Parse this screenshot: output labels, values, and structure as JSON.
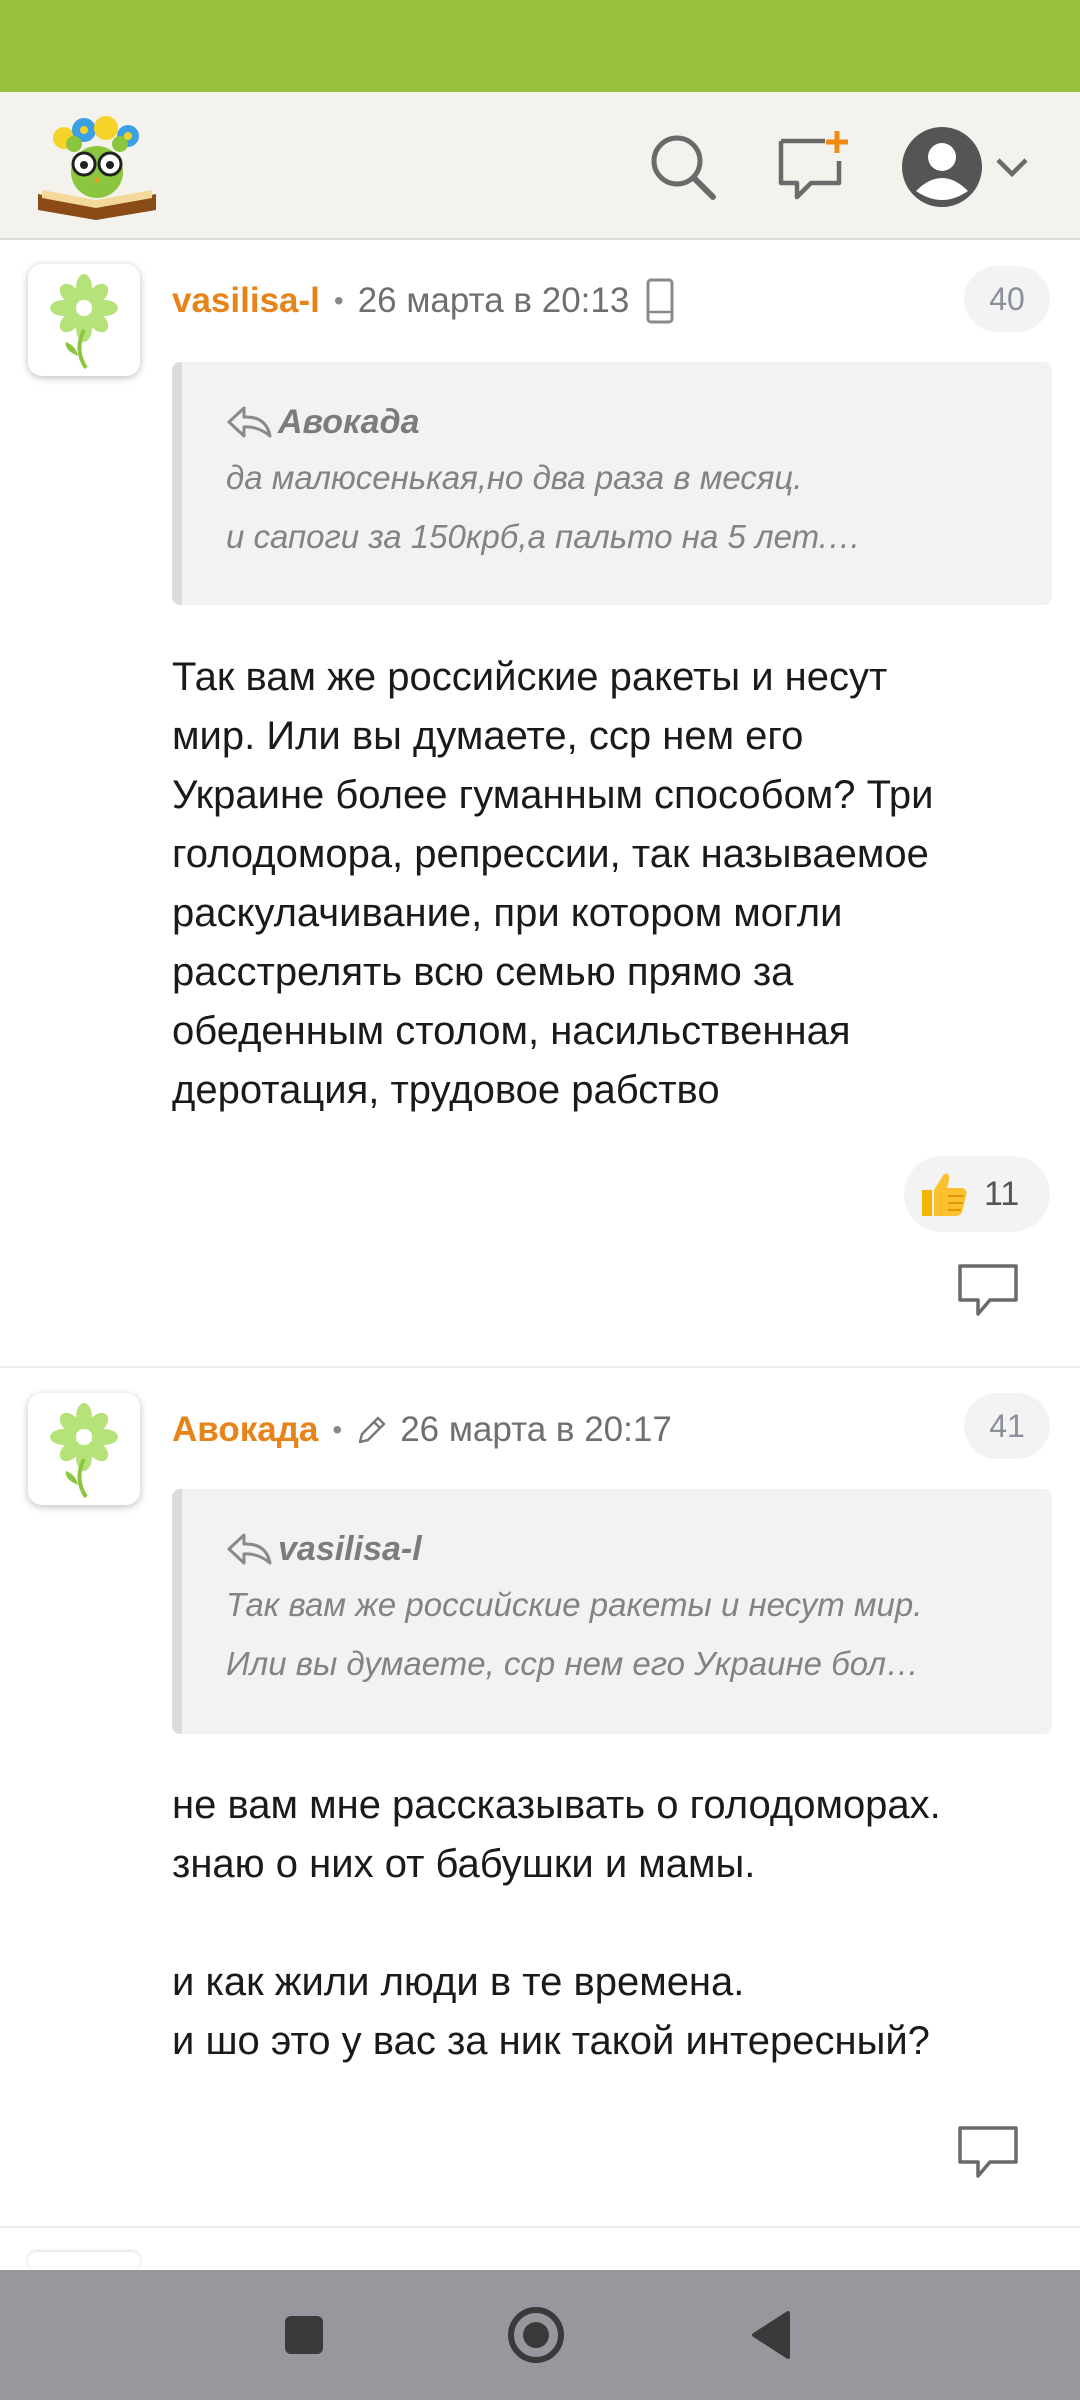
{
  "header": {
    "logo_icon": "reading-owl-logo",
    "search_icon": "search-icon",
    "new_post_icon": "add-comment-icon",
    "profile_icon": "user-avatar-icon",
    "menu_icon": "chevron-down-icon"
  },
  "comments": [
    {
      "author": "vasilisa-l",
      "date": "26 марта в 20:13",
      "device_icon": "mobile-phone-icon",
      "number": "40",
      "quote": {
        "author": "Авокада",
        "lines": [
          "да малюсенькая,но два раза в месяц.",
          "и сапоги за 150крб,а пальто на 5 лет.…"
        ]
      },
      "body": [
        "Так вам же российские ракеты и несут",
        "мир. Или вы думаете, сср нем его",
        "Украине более гуманным способом? Три",
        "голодомора, репрессии, так называемое",
        "раскулачивание, при котором могли",
        "расстрелять всю семью прямо за",
        "обеденным столом, насильственная",
        "деротация, трудовое рабство"
      ],
      "likes": "11"
    },
    {
      "author": "Авокада",
      "date": "26 марта в 20:17",
      "edit_icon": "pencil-icon",
      "number": "41",
      "quote": {
        "author": "vasilisa-l",
        "lines": [
          "Так вам же российские ракеты и несут мир.",
          "Или вы думаете, сср нем его Украине бол…"
        ]
      },
      "body": [
        "не вам мне рассказывать о голодоморах.",
        "знаю о них от бабушки и мамы.",
        "",
        "и как жили люди в те времена.",
        "и шо это у вас за ник такой интересный?"
      ]
    }
  ],
  "colors": {
    "status_bar": "#98c13d",
    "author": "#e6841a",
    "header_bg": "#f3f2ed"
  }
}
